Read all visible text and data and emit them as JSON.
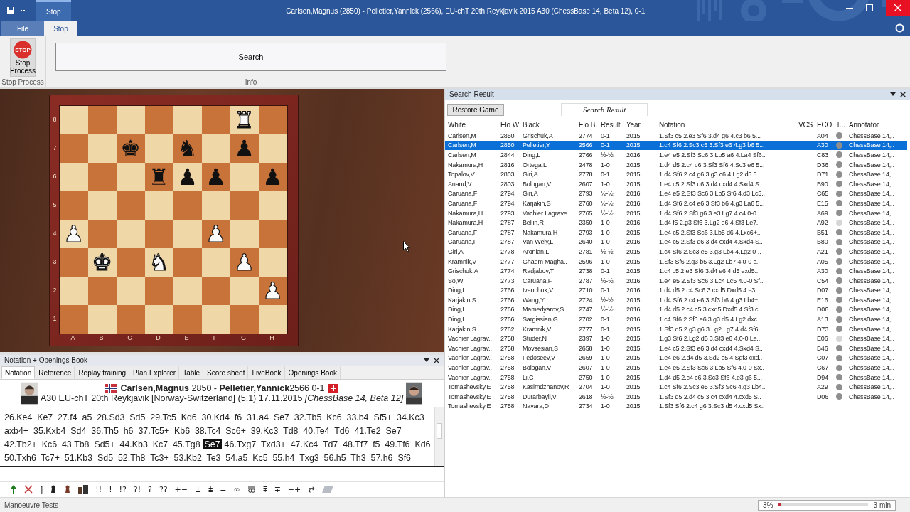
{
  "window": {
    "title": "Carlsen,Magnus (2850) - Pelletier,Yannick (2566), EU-chT 20th Reykjavik 2015  A30  (ChessBase 14, Beta 12), 0-1",
    "contextual_tab": "Stop"
  },
  "ribbon_tabs": [
    {
      "label": "File",
      "selected": false
    },
    {
      "label": "Stop",
      "selected": true
    }
  ],
  "ribbon": {
    "stop_button": "Stop\nProcess",
    "stop_icon_text": "STOP",
    "group_stop": "Stop Process",
    "search_button": "Search",
    "group_info": "Info"
  },
  "board": {
    "ranks": [
      "8",
      "7",
      "6",
      "5",
      "4",
      "3",
      "2",
      "1"
    ],
    "files": [
      "A",
      "B",
      "C",
      "D",
      "E",
      "F",
      "G",
      "H"
    ],
    "rows": [
      [
        {},
        {},
        {},
        {},
        {},
        {},
        {
          "glyph": "♜",
          "white": true
        },
        {}
      ],
      [
        {},
        {},
        {
          "glyph": "♚",
          "white": false
        },
        {},
        {
          "glyph": "♞",
          "white": false
        },
        {},
        {
          "glyph": "♟",
          "white": false
        },
        {}
      ],
      [
        {},
        {},
        {},
        {
          "glyph": "♜",
          "white": false
        },
        {
          "glyph": "♟",
          "white": false
        },
        {
          "glyph": "♟",
          "white": false
        },
        {},
        {
          "glyph": "♟",
          "white": false
        }
      ],
      [
        {},
        {},
        {},
        {},
        {},
        {},
        {},
        {}
      ],
      [
        {
          "glyph": "♟",
          "white": true
        },
        {},
        {},
        {},
        {},
        {
          "glyph": "♟",
          "white": true
        },
        {},
        {}
      ],
      [
        {},
        {
          "glyph": "♚",
          "white": true
        },
        {},
        {
          "glyph": "♞",
          "white": true
        },
        {},
        {},
        {
          "glyph": "♟",
          "white": true
        },
        {}
      ],
      [
        {},
        {},
        {},
        {},
        {},
        {},
        {},
        {
          "glyph": "♟",
          "white": true
        }
      ],
      [
        {},
        {},
        {},
        {},
        {},
        {},
        {},
        {}
      ]
    ]
  },
  "notation_panel": {
    "title": "Notation + Openings Book",
    "tabs": [
      {
        "label": "Notation",
        "selected": true
      },
      {
        "label": "Reference",
        "selected": false
      },
      {
        "label": "Replay training",
        "selected": false
      },
      {
        "label": "Plan Explorer",
        "selected": false
      },
      {
        "label": "Table",
        "selected": false
      },
      {
        "label": "Score sheet",
        "selected": false
      },
      {
        "label": "LiveBook",
        "selected": false
      },
      {
        "label": "Openings Book",
        "selected": false
      }
    ],
    "players_line": "**Carlsen,Magnus** 2850 - **Pelletier,Yannick**2566  0-1",
    "event_line": "A30 EU-chT 20th Reykjavik [Norway-Switzerland] (5.1) 17.11.2015 *[ChessBase 14, Beta 12]*",
    "lines": [
      [
        {
          "text": "26.Ke4  Ke7  27.f4  a5  28.Sd3  Sd5  29.Tc5  Kd6  30.Kd4  f6  31.a4  Se7  32.Tb5  Kc6  33.b4  Sf5+  34.Kc3",
          "selected": false
        }
      ],
      [
        {
          "text": "axb4+  35.Kxb4  Sd4  36.Th5  h6  37.Tc5+  Kb6  38.Tc4  Sc6+  39.Kc3  Td8  40.Te4  Td6  41.Te2  Se7",
          "selected": false
        }
      ],
      [
        {
          "text": "42.Tb2+  Kc6  43.Tb8  Sd5+  44.Kb3  Kc7  45.Tg8",
          "selected": false
        },
        {
          "text": "Se7",
          "selected": true
        },
        {
          "text": "46.Txg7  Txd3+  47.Kc4  Td7  48.Tf7  f5  49.Tf6  Kd6",
          "selected": false
        }
      ],
      [
        {
          "text": "50.Txh6  Tc7+  51.Kb3  Sd5  52.Th8  Tc3+  53.Kb2  Te3  54.a5  Kc5  55.h4  Txg3  56.h5  Th3  57.h6  Sf6",
          "selected": false
        }
      ]
    ],
    "bracket": "]",
    "annotation_symbols": [
      "!!",
      "!",
      "!?",
      "?!",
      "?",
      "??"
    ],
    "evaluation_symbols": [
      "+−",
      "±",
      "⩲",
      "=",
      "∞"
    ],
    "evaluation_symbols_2": [
      "⩱",
      "∓",
      "−+",
      "⇄"
    ]
  },
  "search_panel": {
    "title": "Search Result",
    "restore_button": "Restore Game",
    "tab": "Search Result"
  },
  "table": {
    "columns": [
      "White",
      "Elo W",
      "Black",
      "Elo B",
      "Result",
      "Year",
      "Notation",
      "VCS",
      "ECO",
      "T...",
      "Annotator"
    ],
    "rows": [
      {
        "white": "Carlsen,M",
        "elo_w": "2850",
        "black": "Grischuk,A",
        "elo_b": "2774",
        "result": "0-1",
        "year": "2015",
        "notation": "1.Sf3 c5 2.e3 Sf6 3.d4 g6 4.c3 b6 5...",
        "eco": "A04",
        "color": "#8e8e8e",
        "annotator": "ChessBase 14,..",
        "selected": false
      },
      {
        "white": "Carlsen,M",
        "elo_w": "2850",
        "black": "Pelletier,Y",
        "elo_b": "2566",
        "result": "0-1",
        "year": "2015",
        "notation": "1.c4 Sf6 2.Sc3 c5 3.Sf3 e6 4.g3 b6 5...",
        "eco": "A30",
        "color": "#8e8e8e",
        "annotator": "ChessBase 14,..",
        "selected": true
      },
      {
        "white": "Carlsen,M",
        "elo_w": "2844",
        "black": "Ding,L",
        "elo_b": "2766",
        "result": "½-½",
        "year": "2016",
        "notation": "1.e4 e5 2.Sf3 Sc6 3.Lb5 a6 4.La4 Sf6..",
        "eco": "C83",
        "color": "#8e8e8e",
        "annotator": "ChessBase 14,..",
        "selected": false
      },
      {
        "white": "Nakamura,H",
        "elo_w": "2816",
        "black": "Ortega,L",
        "elo_b": "2478",
        "result": "1-0",
        "year": "2015",
        "notation": "1.d4 d5 2.c4 c6 3.Sf3 Sf6 4.Sc3 e6 5...",
        "eco": "D36",
        "color": "#8e8e8e",
        "annotator": "ChessBase 14,..",
        "selected": false
      },
      {
        "white": "Topalov,V",
        "elo_w": "2803",
        "black": "Giri,A",
        "elo_b": "2778",
        "result": "0-1",
        "year": "2015",
        "notation": "1.d4 Sf6 2.c4 g6 3.g3 c6 4.Lg2 d5 5...",
        "eco": "D71",
        "color": "#8e8e8e",
        "annotator": "ChessBase 14,..",
        "selected": false
      },
      {
        "white": "Anand,V",
        "elo_w": "2803",
        "black": "Bologan,V",
        "elo_b": "2607",
        "result": "1-0",
        "year": "2015",
        "notation": "1.e4 c5 2.Sf3 d6 3.d4 cxd4 4.Sxd4 S..",
        "eco": "B90",
        "color": "#8e8e8e",
        "annotator": "ChessBase 14,..",
        "selected": false
      },
      {
        "white": "Caruana,F",
        "elo_w": "2794",
        "black": "Giri,A",
        "elo_b": "2793",
        "result": "½-½",
        "year": "2016",
        "notation": "1.e4 e5 2.Sf3 Sc6 3.Lb5 Sf6 4.d3 Lc5..",
        "eco": "C65",
        "color": "#8e8e8e",
        "annotator": "ChessBase 14,..",
        "selected": false
      },
      {
        "white": "Caruana,F",
        "elo_w": "2794",
        "black": "Karjakin,S",
        "elo_b": "2760",
        "result": "½-½",
        "year": "2016",
        "notation": "1.d4 Sf6 2.c4 e6 3.Sf3 b6 4.g3 La6 5...",
        "eco": "E15",
        "color": "#8e8e8e",
        "annotator": "ChessBase 14,..",
        "selected": false
      },
      {
        "white": "Nakamura,H",
        "elo_w": "2793",
        "black": "Vachier Lagrave..",
        "elo_b": "2765",
        "result": "½-½",
        "year": "2015",
        "notation": "1.d4 Sf6 2.Sf3 g6 3.e3 Lg7 4.c4 0-0..",
        "eco": "A69",
        "color": "#8e8e8e",
        "annotator": "ChessBase 14,..",
        "selected": false
      },
      {
        "white": "Nakamura,H",
        "elo_w": "2787",
        "black": "Bellin,R",
        "elo_b": "2350",
        "result": "1-0",
        "year": "2016",
        "notation": "1.d4 f5 2.g3 Sf6 3.Lg2 e6 4.Sf3 Le7..",
        "eco": "A92",
        "color": "#d6d6d6",
        "annotator": "ChessBase 14,..",
        "selected": false
      },
      {
        "white": "Caruana,F",
        "elo_w": "2787",
        "black": "Nakamura,H",
        "elo_b": "2793",
        "result": "1-0",
        "year": "2015",
        "notation": "1.e4 c5 2.Sf3 Sc6 3.Lb5 d6 4.Lxc6+..",
        "eco": "B51",
        "color": "#8e8e8e",
        "annotator": "ChessBase 14,..",
        "selected": false
      },
      {
        "white": "Caruana,F",
        "elo_w": "2787",
        "black": "Van Wely,L",
        "elo_b": "2640",
        "result": "1-0",
        "year": "2016",
        "notation": "1.e4 c5 2.Sf3 d6 3.d4 cxd4 4.Sxd4 S..",
        "eco": "B80",
        "color": "#8e8e8e",
        "annotator": "ChessBase 14,..",
        "selected": false
      },
      {
        "white": "Giri,A",
        "elo_w": "2778",
        "black": "Aronian,L",
        "elo_b": "2781",
        "result": "½-½",
        "year": "2015",
        "notation": "1.c4 Sf6 2.Sc3 e5 3.g3 Lb4 4.Lg2 0-..",
        "eco": "A21",
        "color": "#8e8e8e",
        "annotator": "ChessBase 14,..",
        "selected": false
      },
      {
        "white": "Kramnik,V",
        "elo_w": "2777",
        "black": "Ghaem Magha..",
        "elo_b": "2596",
        "result": "1-0",
        "year": "2015",
        "notation": "1.Sf3 Sf6 2.g3 b5 3.Lg2 Lb7 4.0-0 c..",
        "eco": "A05",
        "color": "#8e8e8e",
        "annotator": "ChessBase 14,..",
        "selected": false
      },
      {
        "white": "Grischuk,A",
        "elo_w": "2774",
        "black": "Radjabov,T",
        "elo_b": "2738",
        "result": "0-1",
        "year": "2015",
        "notation": "1.c4 c5 2.e3 Sf6 3.d4 e6 4.d5 exd5..",
        "eco": "A30",
        "color": "#8e8e8e",
        "annotator": "ChessBase 14,..",
        "selected": false
      },
      {
        "white": "So,W",
        "elo_w": "2773",
        "black": "Caruana,F",
        "elo_b": "2787",
        "result": "½-½",
        "year": "2016",
        "notation": "1.e4 e5 2.Sf3 Sc6 3.Lc4 Lc5 4.0-0 Sf..",
        "eco": "C54",
        "color": "#8e8e8e",
        "annotator": "ChessBase 14,..",
        "selected": false
      },
      {
        "white": "Ding,L",
        "elo_w": "2766",
        "black": "Ivanchuk,V",
        "elo_b": "2710",
        "result": "0-1",
        "year": "2016",
        "notation": "1.d4 d5 2.c4 Sc6 3.cxd5 Dxd5 4.e3..",
        "eco": "D07",
        "color": "#8e8e8e",
        "annotator": "ChessBase 14,..",
        "selected": false
      },
      {
        "white": "Karjakin,S",
        "elo_w": "2766",
        "black": "Wang,Y",
        "elo_b": "2724",
        "result": "½-½",
        "year": "2015",
        "notation": "1.d4 Sf6 2.c4 e6 3.Sf3 b6 4.g3 Lb4+..",
        "eco": "E16",
        "color": "#8e8e8e",
        "annotator": "ChessBase 14,..",
        "selected": false
      },
      {
        "white": "Ding,L",
        "elo_w": "2766",
        "black": "Mamedyarov,S",
        "elo_b": "2747",
        "result": "½-½",
        "year": "2016",
        "notation": "1.d4 d5 2.c4 c5 3.cxd5 Dxd5 4.Sf3 c..",
        "eco": "D06",
        "color": "#8e8e8e",
        "annotator": "ChessBase 14,..",
        "selected": false
      },
      {
        "white": "Ding,L",
        "elo_w": "2766",
        "black": "Sargissian,G",
        "elo_b": "2702",
        "result": "0-1",
        "year": "2016",
        "notation": "1.c4 Sf6 2.Sf3 e6 3.g3 d5 4.Lg2 dxc..",
        "eco": "A13",
        "color": "#8e8e8e",
        "annotator": "ChessBase 14,..",
        "selected": false
      },
      {
        "white": "Karjakin,S",
        "elo_w": "2762",
        "black": "Kramnik,V",
        "elo_b": "2777",
        "result": "0-1",
        "year": "2015",
        "notation": "1.Sf3 d5 2.g3 g6 3.Lg2 Lg7 4.d4 Sf6..",
        "eco": "D73",
        "color": "#8e8e8e",
        "annotator": "ChessBase 14,..",
        "selected": false
      },
      {
        "white": "Vachier Lagrav..",
        "elo_w": "2758",
        "black": "Studer,N",
        "elo_b": "2397",
        "result": "1-0",
        "year": "2015",
        "notation": "1.g3 Sf6 2.Lg2 d5 3.Sf3 e6 4.0-0 Le..",
        "eco": "E06",
        "color": "#d6d6d6",
        "annotator": "ChessBase 14,..",
        "selected": false
      },
      {
        "white": "Vachier Lagrav..",
        "elo_w": "2758",
        "black": "Movsesian,S",
        "elo_b": "2658",
        "result": "1-0",
        "year": "2015",
        "notation": "1.e4 c5 2.Sf3 e6 3.d4 cxd4 4.Sxd4 S..",
        "eco": "B46",
        "color": "#8e8e8e",
        "annotator": "ChessBase 14,..",
        "selected": false
      },
      {
        "white": "Vachier Lagrav..",
        "elo_w": "2758",
        "black": "Fedoseev,V",
        "elo_b": "2659",
        "result": "1-0",
        "year": "2015",
        "notation": "1.e4 e6 2.d4 d5 3.Sd2 c5 4.Sgf3 cxd..",
        "eco": "C07",
        "color": "#8e8e8e",
        "annotator": "ChessBase 14,..",
        "selected": false
      },
      {
        "white": "Vachier Lagrav..",
        "elo_w": "2758",
        "black": "Bologan,V",
        "elo_b": "2607",
        "result": "1-0",
        "year": "2015",
        "notation": "1.e4 e5 2.Sf3 Sc6 3.Lb5 Sf6 4.0-0 Sx..",
        "eco": "C67",
        "color": "#8e8e8e",
        "annotator": "ChessBase 14,..",
        "selected": false
      },
      {
        "white": "Vachier Lagrav..",
        "elo_w": "2758",
        "black": "Li,C",
        "elo_b": "2750",
        "result": "1-0",
        "year": "2015",
        "notation": "1.d4 d5 2.c4 c6 3.Sc3 Sf6 4.e3 g6 5...",
        "eco": "D94",
        "color": "#8e8e8e",
        "annotator": "ChessBase 14,..",
        "selected": false
      },
      {
        "white": "Tomashevsky,E",
        "elo_w": "2758",
        "black": "Kasimdzhanov,R",
        "elo_b": "2704",
        "result": "1-0",
        "year": "2015",
        "notation": "1.c4 Sf6 2.Sc3 e5 3.Sf3 Sc6 4.g3 Lb4..",
        "eco": "A29",
        "color": "#8e8e8e",
        "annotator": "ChessBase 14,..",
        "selected": false
      },
      {
        "white": "Tomashevsky,E",
        "elo_w": "2758",
        "black": "Durarbayli,V",
        "elo_b": "2618",
        "result": "½-½",
        "year": "2015",
        "notation": "1.Sf3 d5 2.d4 c5 3.c4 cxd4 4.cxd5 S..",
        "eco": "D06",
        "color": "#8e8e8e",
        "annotator": "ChessBase 14,..",
        "selected": false
      },
      {
        "white": "Tomashevsky,E",
        "elo_w": "2758",
        "black": "Navara,D",
        "elo_b": "2734",
        "result": "1-0",
        "year": "2015",
        "notation": "1.Sf3 Sf6 2.c4 g6 3.Sc3 d5 4.cxd5 Sx..",
        "selected": false
      }
    ]
  },
  "status_bar": {
    "text": "Manoeuvre Tests",
    "percent": "3%",
    "level": 0.03,
    "time": "3 min"
  }
}
